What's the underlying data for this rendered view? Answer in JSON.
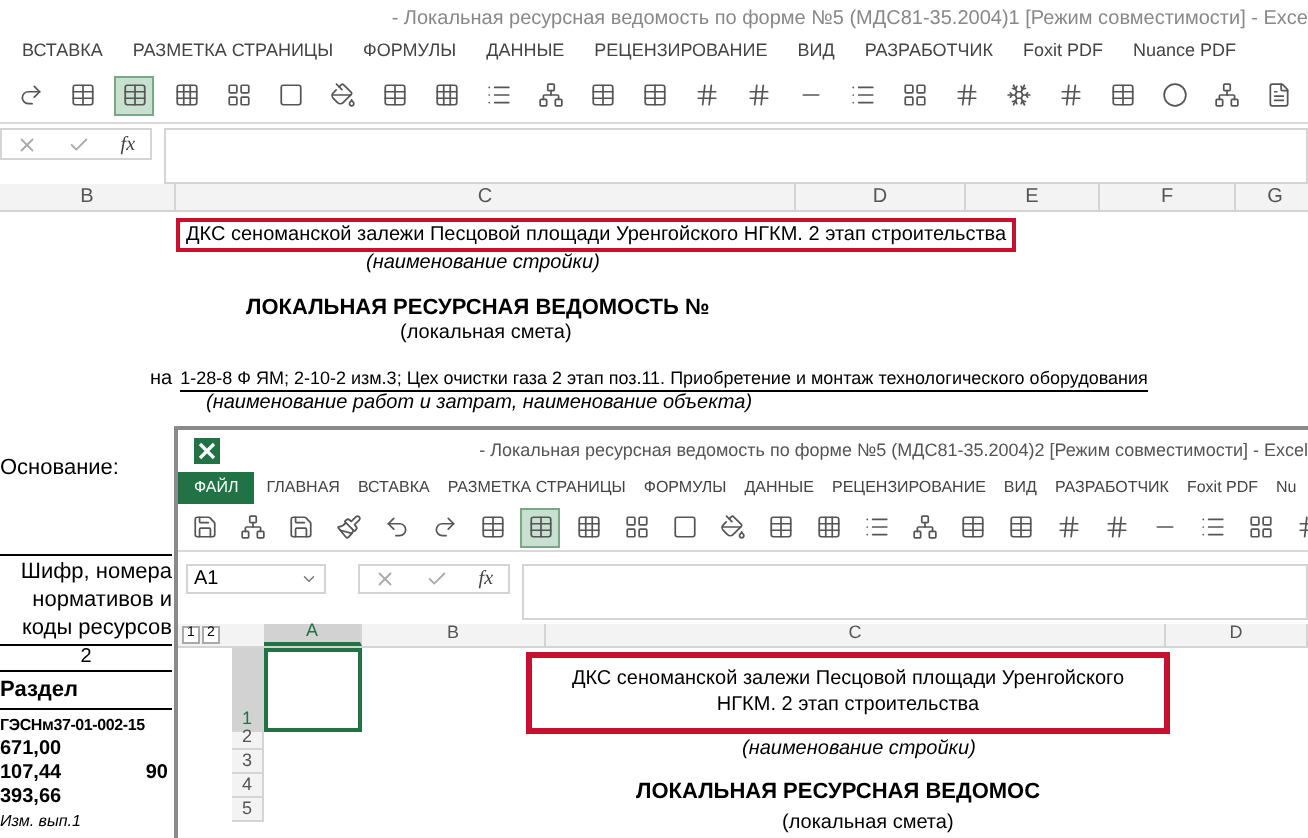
{
  "back_window": {
    "title": "- Локальная ресурсная ведомость по форме №5 (МДС81-35.2004)1  [Режим совместимости] - Exce",
    "tabs": [
      {
        "label": "ВСТАВКА",
        "kind": "tab"
      },
      {
        "label": "РАЗМЕТКА СТРАНИЦЫ",
        "kind": "tab"
      },
      {
        "label": "ФОРМУЛЫ",
        "kind": "tab"
      },
      {
        "label": "ДАННЫЕ",
        "kind": "tab"
      },
      {
        "label": "РЕЦЕНЗИРОВАНИЕ",
        "kind": "tab"
      },
      {
        "label": "ВИД",
        "kind": "tab"
      },
      {
        "label": "РАЗРАБОТЧИК",
        "kind": "tab"
      },
      {
        "label": "Foxit PDF",
        "kind": "tab"
      },
      {
        "label": "Nuance PDF",
        "kind": "tab"
      }
    ],
    "formula_bar": {
      "function_label": "fx"
    },
    "columns": [
      "B",
      "C",
      "D",
      "E",
      "F",
      "G"
    ],
    "sheet": {
      "construction_name": "ДКС сеноманской залежи Песцовой площади Уренгойского НГКМ. 2 этап строительства",
      "construction_caption": "(наименование стройки)",
      "heading": "ЛОКАЛЬНАЯ РЕСУРСНАЯ ВЕДОМОСТЬ  №",
      "heading_caption": "(локальная смета)",
      "work_prefix": "на",
      "work_name": "1-28-8 Ф ЯМ;   2-10-2 изм.3;   Цех очистки газа 2 этап  поз.11. Приобретение и монтаж технологического оборудования",
      "work_caption": "(наименование работ и затрат, наименование объекта)",
      "basis_label": "Основание:",
      "table_header": "Шифр, номера нормативов и коды ресурсов",
      "column_number": "2",
      "rows": [
        {
          "text": "Раздел",
          "kind": "section"
        },
        {
          "text": "ГЭСНм37-01-002-15",
          "kind": "code"
        },
        {
          "text": "671,00",
          "kind": "value"
        },
        {
          "text": "107,44",
          "extra": "90",
          "kind": "value"
        },
        {
          "text": "393,66",
          "kind": "value"
        },
        {
          "text": "Изм. вып.1",
          "kind": "note"
        }
      ]
    }
  },
  "front_window": {
    "title": "- Локальная ресурсная ведомость по форме №5 (МДС81-35.2004)2  [Режим совместимости] - Excel",
    "tabs": [
      {
        "label": "ФАЙЛ",
        "kind": "file"
      },
      {
        "label": "ГЛАВНАЯ",
        "kind": "tab"
      },
      {
        "label": "ВСТАВКА",
        "kind": "tab"
      },
      {
        "label": "РАЗМЕТКА СТРАНИЦЫ",
        "kind": "tab"
      },
      {
        "label": "ФОРМУЛЫ",
        "kind": "tab"
      },
      {
        "label": "ДАННЫЕ",
        "kind": "tab"
      },
      {
        "label": "РЕЦЕНЗИРОВАНИЕ",
        "kind": "tab"
      },
      {
        "label": "ВИД",
        "kind": "tab"
      },
      {
        "label": "РАЗРАБОТЧИК",
        "kind": "tab"
      },
      {
        "label": "Foxit PDF",
        "kind": "tab"
      },
      {
        "label": "Nu",
        "kind": "tab"
      }
    ],
    "name_box": "A1",
    "formula_bar": {
      "function_label": "fx"
    },
    "outline_levels": [
      "1",
      "2"
    ],
    "columns": [
      {
        "label": "A",
        "selected": true
      },
      {
        "label": "B",
        "selected": false
      },
      {
        "label": "C",
        "selected": false
      },
      {
        "label": "D",
        "selected": false
      }
    ],
    "rows": [
      {
        "label": "1",
        "selected": true
      },
      {
        "label": "2",
        "selected": false
      },
      {
        "label": "3",
        "selected": false
      },
      {
        "label": "4",
        "selected": false
      },
      {
        "label": "5",
        "selected": false
      }
    ],
    "sheet": {
      "construction_name": "ДКС сеноманской залежи Песцовой площади Уренгойского НГКМ. 2 этап строительства",
      "construction_caption": "(наименование стройки)",
      "heading": "ЛОКАЛЬНАЯ РЕСУРСНАЯ ВЕДОМОС",
      "heading_caption": "(локальная смета)"
    }
  }
}
